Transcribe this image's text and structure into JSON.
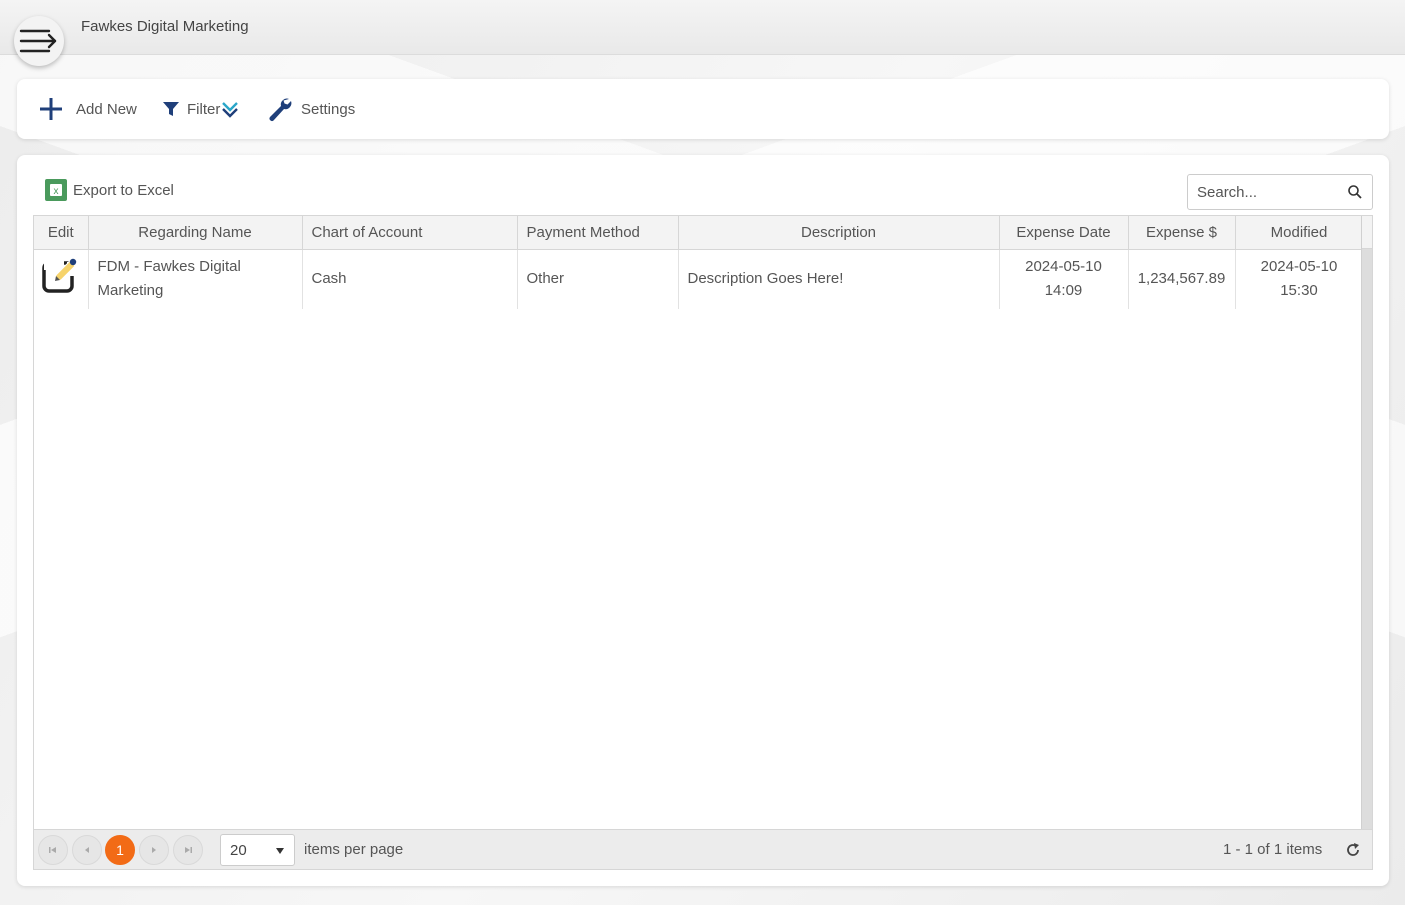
{
  "app": {
    "title": "Fawkes Digital Marketing"
  },
  "toolbar": {
    "add_new_label": "Add New",
    "filter_label": "Filter",
    "settings_label": "Settings"
  },
  "grid_toolbar": {
    "export_label": "Export to Excel",
    "search_placeholder": "Search..."
  },
  "table": {
    "columns": [
      "Edit",
      "Regarding Name",
      "Chart of Account",
      "Payment Method",
      "Description",
      "Expense Date",
      "Expense $",
      "Modified"
    ],
    "rows": [
      {
        "regarding_name": "FDM - Fawkes Digital Marketing",
        "chart_of_account": "Cash",
        "payment_method": "Other",
        "description": "Description Goes Here!",
        "expense_date": "2024-05-10 14:09",
        "expense": "1,234,567.89",
        "modified": "2024-05-10 15:30"
      }
    ]
  },
  "pager": {
    "current_page": "1",
    "page_size": "20",
    "items_per_page_label": "items per page",
    "info": "1 - 1 of 1 items"
  },
  "colors": {
    "accent": "#f26b16",
    "icon_blue": "#1f3f7a",
    "excel_green": "#4a9a5c"
  }
}
